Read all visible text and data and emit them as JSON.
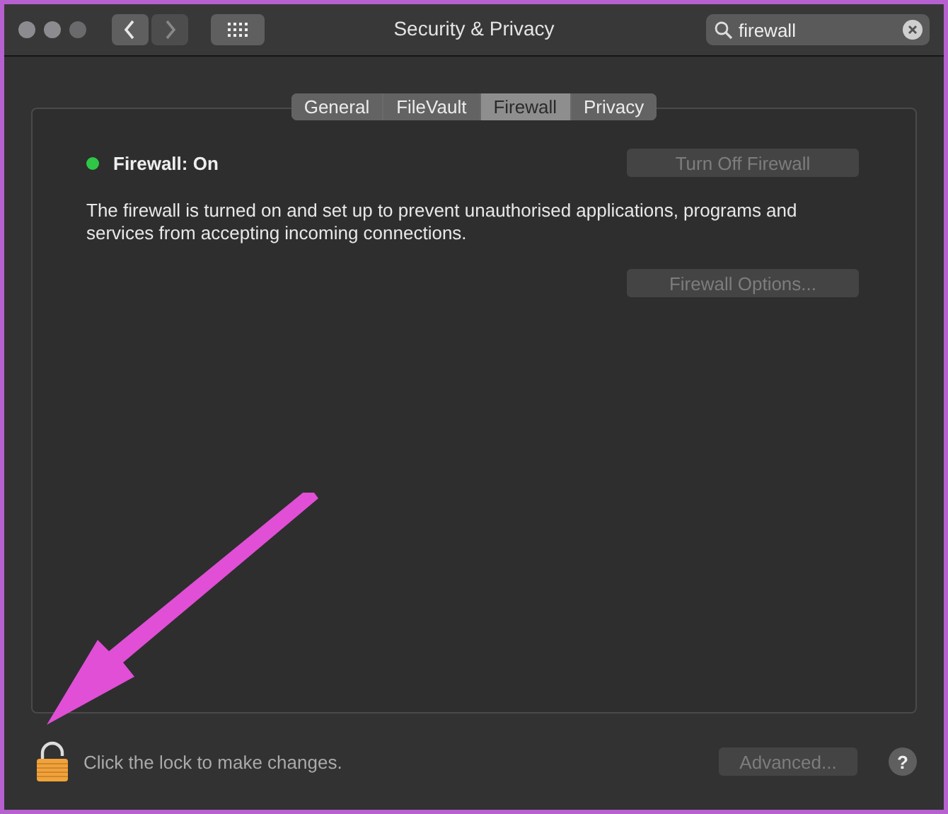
{
  "window": {
    "title": "Security & Privacy"
  },
  "toolbar": {
    "back": {
      "disabled": false
    },
    "forward": {
      "disabled": true
    }
  },
  "search": {
    "value": "firewall"
  },
  "tabs": [
    {
      "label": "General",
      "selected": false
    },
    {
      "label": "FileVault",
      "selected": false
    },
    {
      "label": "Firewall",
      "selected": true
    },
    {
      "label": "Privacy",
      "selected": false
    }
  ],
  "firewall": {
    "status": "Firewall: On",
    "on": true,
    "description": "The firewall is turned on and set up to prevent unauthorised applications, programs and services from accepting incoming connections.",
    "toggle_button": {
      "label": "Turn Off Firewall",
      "disabled": true
    },
    "options_button": {
      "label": "Firewall Options...",
      "disabled": true
    }
  },
  "footer": {
    "lock_text": "Click the lock to make changes.",
    "locked": false,
    "advanced_button": {
      "label": "Advanced...",
      "disabled": true
    },
    "help_button": "?"
  }
}
